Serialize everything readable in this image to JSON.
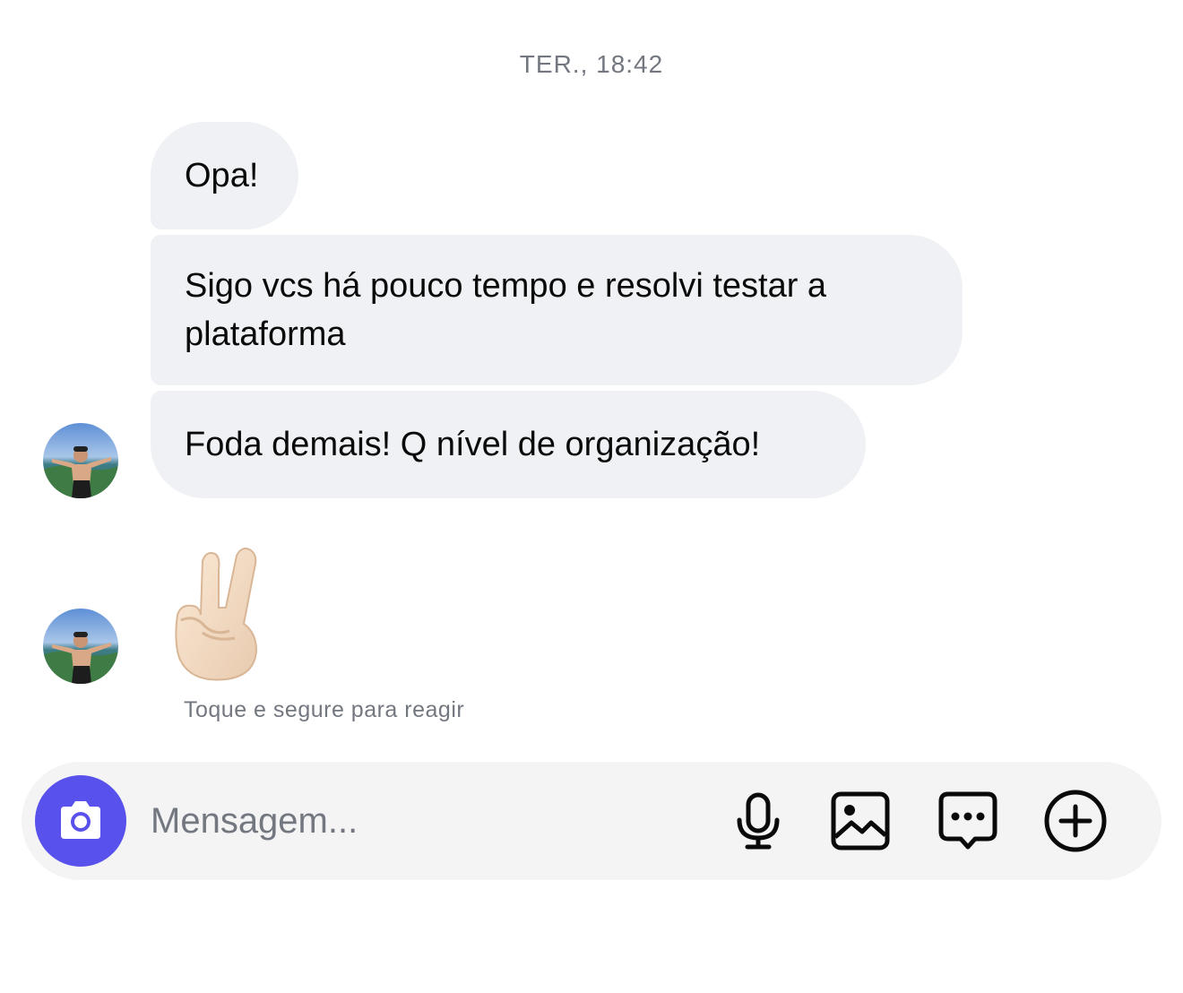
{
  "conversation": {
    "timestamp": "TER., 18:42",
    "messages": [
      {
        "text": "Opa!"
      },
      {
        "text": "Sigo vcs há pouco tempo e resolvi testar a plataforma"
      },
      {
        "text": "Foda demais! Q nível de organização!"
      }
    ],
    "emoji_message": {
      "emoji": "victory-hand",
      "label": "✌🏻"
    },
    "reaction_hint": "Toque e segure para reagir"
  },
  "composer": {
    "placeholder": "Mensagem...",
    "camera_icon": "camera-icon",
    "tools": [
      "microphone-icon",
      "image-icon",
      "chat-more-icon",
      "plus-circle-icon"
    ],
    "accent_color": "#5851ec"
  },
  "colors": {
    "bubble": "#eff1f4",
    "composer_bg": "#f4f4f5",
    "muted_text": "#737780"
  }
}
